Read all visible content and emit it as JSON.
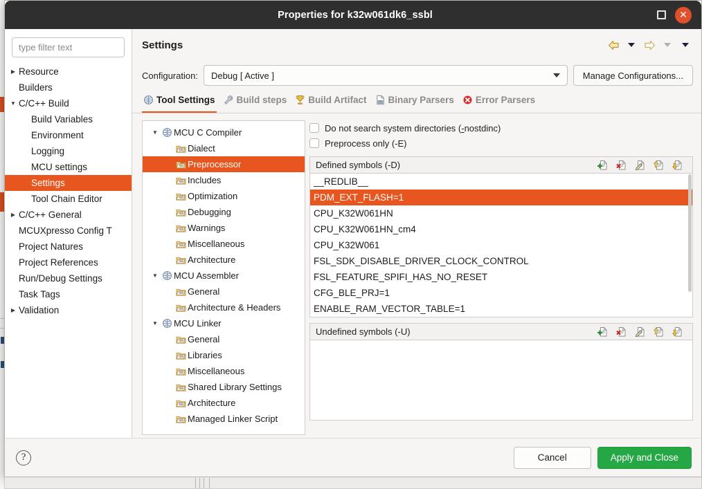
{
  "window": {
    "title": "Properties for k32w061dk6_ssbl",
    "maximize_icon": "maximize-icon",
    "close_icon": "close-icon"
  },
  "sidebar": {
    "filter_placeholder": "type filter text",
    "filter_value": "",
    "items": [
      {
        "label": "Resource",
        "depth": 0,
        "twisty": "collapsed",
        "selected": false
      },
      {
        "label": "Builders",
        "depth": 0,
        "twisty": "none",
        "selected": false
      },
      {
        "label": "C/C++ Build",
        "depth": 0,
        "twisty": "expanded",
        "selected": false
      },
      {
        "label": "Build Variables",
        "depth": 1,
        "twisty": "none",
        "selected": false
      },
      {
        "label": "Environment",
        "depth": 1,
        "twisty": "none",
        "selected": false
      },
      {
        "label": "Logging",
        "depth": 1,
        "twisty": "none",
        "selected": false
      },
      {
        "label": "MCU settings",
        "depth": 1,
        "twisty": "none",
        "selected": false
      },
      {
        "label": "Settings",
        "depth": 1,
        "twisty": "none",
        "selected": true
      },
      {
        "label": "Tool Chain Editor",
        "depth": 1,
        "twisty": "none",
        "selected": false
      },
      {
        "label": "C/C++ General",
        "depth": 0,
        "twisty": "collapsed",
        "selected": false
      },
      {
        "label": "MCUXpresso Config T",
        "depth": 0,
        "twisty": "none",
        "selected": false
      },
      {
        "label": "Project Natures",
        "depth": 0,
        "twisty": "none",
        "selected": false
      },
      {
        "label": "Project References",
        "depth": 0,
        "twisty": "none",
        "selected": false
      },
      {
        "label": "Run/Debug Settings",
        "depth": 0,
        "twisty": "none",
        "selected": false
      },
      {
        "label": "Task Tags",
        "depth": 0,
        "twisty": "none",
        "selected": false
      },
      {
        "label": "Validation",
        "depth": 0,
        "twisty": "collapsed",
        "selected": false
      }
    ]
  },
  "header": {
    "page_title": "Settings",
    "nav": [
      {
        "name": "back-arrow-icon",
        "kind": "arrow-left-filled"
      },
      {
        "name": "back-dropdown-icon",
        "kind": "caret-dark"
      },
      {
        "name": "forward-arrow-icon",
        "kind": "arrow-right-outline"
      },
      {
        "name": "forward-dropdown-icon",
        "kind": "caret-gray"
      },
      {
        "name": "view-menu-icon",
        "kind": "caret-dark"
      }
    ]
  },
  "config": {
    "label": "Configuration:",
    "selected": "Debug  [ Active ]",
    "options": [
      "Debug  [ Active ]"
    ],
    "manage_button": "Manage Configurations..."
  },
  "tabs": [
    {
      "label": "Tool Settings",
      "icon": "globe-settings-icon",
      "active": true
    },
    {
      "label": "Build steps",
      "icon": "wrench-icon",
      "active": false
    },
    {
      "label": "Build Artifact",
      "icon": "trophy-icon",
      "active": false
    },
    {
      "label": "Binary Parsers",
      "icon": "binary-file-icon",
      "active": false
    },
    {
      "label": "Error Parsers",
      "icon": "error-circle-icon",
      "active": false
    }
  ],
  "tool_tree": [
    {
      "label": "MCU C Compiler",
      "depth": 0,
      "twisty": "expanded",
      "icon": "tool-icon",
      "selected": false
    },
    {
      "label": "Dialect",
      "depth": 1,
      "twisty": "none",
      "icon": "folder-icon",
      "selected": false
    },
    {
      "label": "Preprocessor",
      "depth": 1,
      "twisty": "none",
      "icon": "folder-icon",
      "selected": true
    },
    {
      "label": "Includes",
      "depth": 1,
      "twisty": "none",
      "icon": "folder-icon",
      "selected": false
    },
    {
      "label": "Optimization",
      "depth": 1,
      "twisty": "none",
      "icon": "folder-icon",
      "selected": false
    },
    {
      "label": "Debugging",
      "depth": 1,
      "twisty": "none",
      "icon": "folder-icon",
      "selected": false
    },
    {
      "label": "Warnings",
      "depth": 1,
      "twisty": "none",
      "icon": "folder-icon",
      "selected": false
    },
    {
      "label": "Miscellaneous",
      "depth": 1,
      "twisty": "none",
      "icon": "folder-icon",
      "selected": false
    },
    {
      "label": "Architecture",
      "depth": 1,
      "twisty": "none",
      "icon": "folder-icon",
      "selected": false
    },
    {
      "label": "MCU Assembler",
      "depth": 0,
      "twisty": "expanded",
      "icon": "tool-icon",
      "selected": false
    },
    {
      "label": "General",
      "depth": 1,
      "twisty": "none",
      "icon": "folder-icon",
      "selected": false
    },
    {
      "label": "Architecture & Headers",
      "depth": 1,
      "twisty": "none",
      "icon": "folder-icon",
      "selected": false
    },
    {
      "label": "MCU Linker",
      "depth": 0,
      "twisty": "expanded",
      "icon": "tool-icon",
      "selected": false
    },
    {
      "label": "General",
      "depth": 1,
      "twisty": "none",
      "icon": "folder-icon",
      "selected": false
    },
    {
      "label": "Libraries",
      "depth": 1,
      "twisty": "none",
      "icon": "folder-icon",
      "selected": false
    },
    {
      "label": "Miscellaneous",
      "depth": 1,
      "twisty": "none",
      "icon": "folder-icon",
      "selected": false
    },
    {
      "label": "Shared Library Settings",
      "depth": 1,
      "twisty": "none",
      "icon": "folder-icon",
      "selected": false
    },
    {
      "label": "Architecture",
      "depth": 1,
      "twisty": "none",
      "icon": "folder-icon",
      "selected": false
    },
    {
      "label": "Managed Linker Script",
      "depth": 1,
      "twisty": "none",
      "icon": "folder-icon",
      "selected": false
    }
  ],
  "options": {
    "checkboxes": [
      {
        "label": "Do not search system directories (-nostdinc)",
        "checked": false
      },
      {
        "label": "Preprocess only (-E)",
        "checked": false
      }
    ],
    "defined": {
      "title": "Defined symbols (-D)",
      "tools": [
        {
          "name": "add-symbol-icon",
          "kind": "add"
        },
        {
          "name": "delete-symbol-icon",
          "kind": "delete"
        },
        {
          "name": "edit-symbol-icon",
          "kind": "edit"
        },
        {
          "name": "move-up-icon",
          "kind": "up"
        },
        {
          "name": "move-down-icon",
          "kind": "down"
        }
      ],
      "items": [
        {
          "value": "__REDLIB__",
          "selected": false
        },
        {
          "value": "PDM_EXT_FLASH=1",
          "selected": true
        },
        {
          "value": "CPU_K32W061HN",
          "selected": false
        },
        {
          "value": "CPU_K32W061HN_cm4",
          "selected": false
        },
        {
          "value": "CPU_K32W061",
          "selected": false
        },
        {
          "value": "FSL_SDK_DISABLE_DRIVER_CLOCK_CONTROL",
          "selected": false
        },
        {
          "value": "FSL_FEATURE_SPIFI_HAS_NO_RESET",
          "selected": false
        },
        {
          "value": "CFG_BLE_PRJ=1",
          "selected": false
        },
        {
          "value": "ENABLE_RAM_VECTOR_TABLE=1",
          "selected": false
        }
      ]
    },
    "undefined": {
      "title": "Undefined symbols (-U)",
      "tools": [
        {
          "name": "add-symbol-icon",
          "kind": "add"
        },
        {
          "name": "delete-symbol-icon",
          "kind": "delete"
        },
        {
          "name": "edit-symbol-icon",
          "kind": "edit"
        },
        {
          "name": "move-up-icon",
          "kind": "up"
        },
        {
          "name": "move-down-icon",
          "kind": "down"
        }
      ],
      "items": []
    }
  },
  "footer": {
    "help_glyph": "?",
    "cancel": "Cancel",
    "apply": "Apply and Close"
  },
  "colors": {
    "selection": "#e8561f",
    "titlebar": "#2f2f2f",
    "close": "#e0502a",
    "primary_button": "#26a745"
  }
}
